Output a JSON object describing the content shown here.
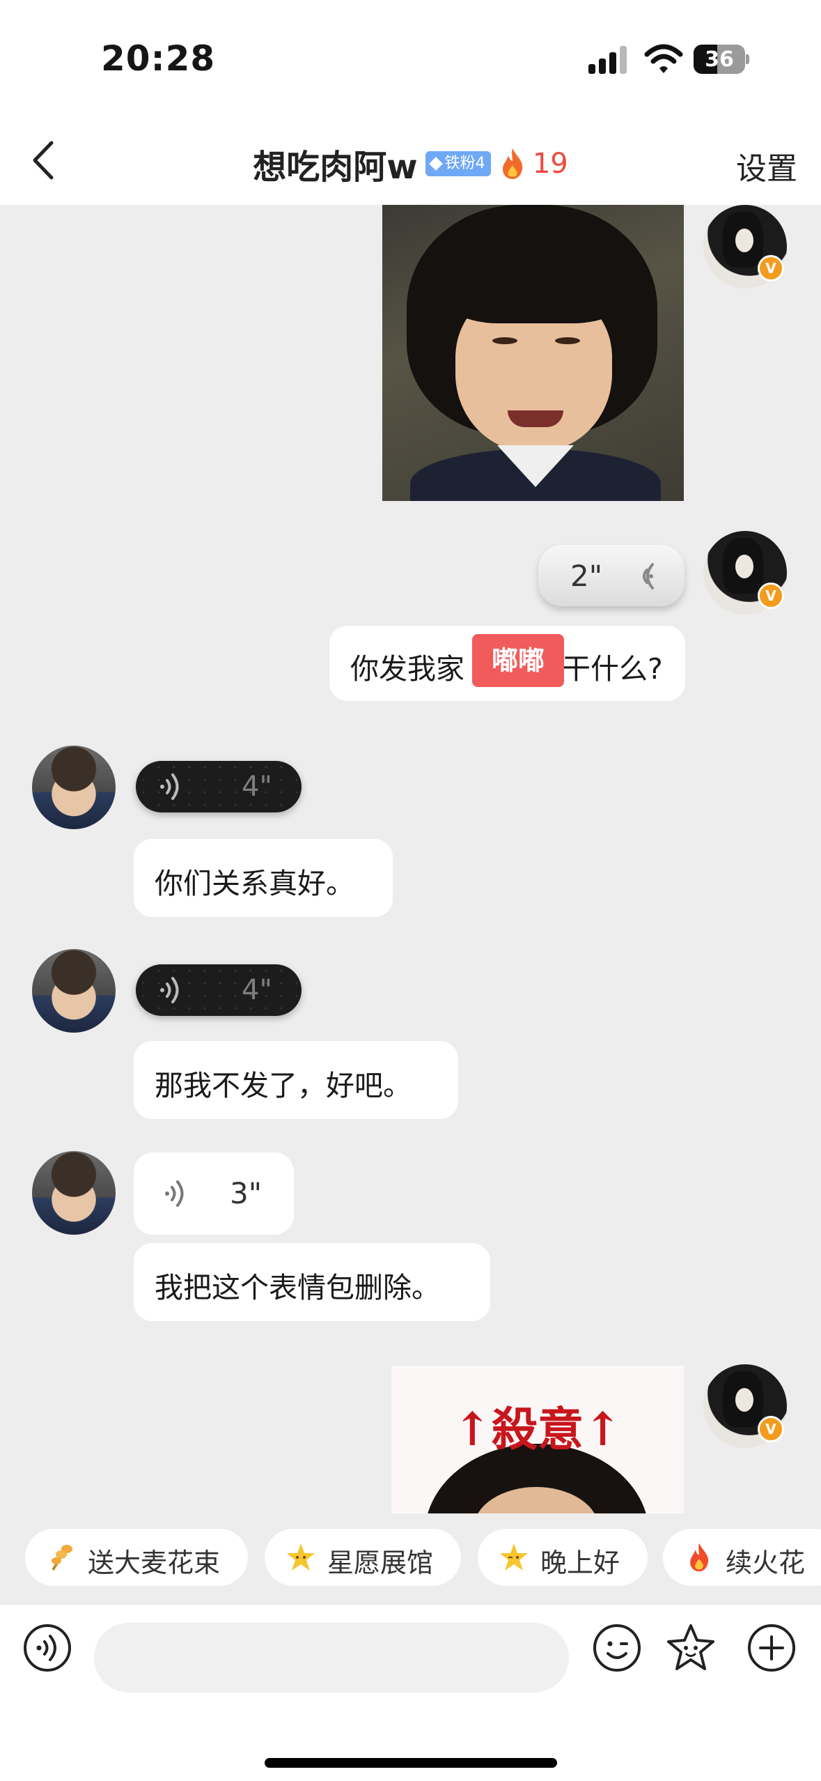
{
  "status_bar": {
    "time": "20:28",
    "battery": "36"
  },
  "header": {
    "title": "想吃肉阿w",
    "fan_badge": "铁粉4",
    "streak_count": "19",
    "settings_label": "设置"
  },
  "messages": [
    {
      "sender": "me",
      "type": "image",
      "icon": "crying-boy-photo"
    },
    {
      "sender": "me",
      "type": "voice",
      "duration": "2\""
    },
    {
      "sender": "me",
      "type": "text",
      "text_before": "你发我家",
      "text_after": "干什么?",
      "overlay_tag": "嘟嘟"
    },
    {
      "sender": "them",
      "type": "voice",
      "duration": "4\""
    },
    {
      "sender": "them",
      "type": "text",
      "text": "你们关系真好。"
    },
    {
      "sender": "them",
      "type": "voice",
      "duration": "4\""
    },
    {
      "sender": "them",
      "type": "text",
      "text": "那我不发了，好吧。"
    },
    {
      "sender": "them",
      "type": "voice",
      "duration": "3\""
    },
    {
      "sender": "them",
      "type": "text",
      "text": "我把这个表情包删除。"
    },
    {
      "sender": "me",
      "type": "image",
      "caption": "↑殺意↑"
    }
  ],
  "quick_replies": [
    {
      "label": "送大麦花束",
      "icon": "wheat-bouquet-icon"
    },
    {
      "label": "星愿展馆",
      "icon": "star-face-icon"
    },
    {
      "label": "晚上好",
      "icon": "star-wink-icon"
    },
    {
      "label": "续火花",
      "icon": "fire-icon"
    }
  ],
  "input": {
    "placeholder": "",
    "value": ""
  },
  "colors": {
    "accent_red": "#ef4a3f",
    "badge_blue": "#6fa8f5",
    "verified_orange": "#f39b1d",
    "chat_bg": "#ededed"
  }
}
